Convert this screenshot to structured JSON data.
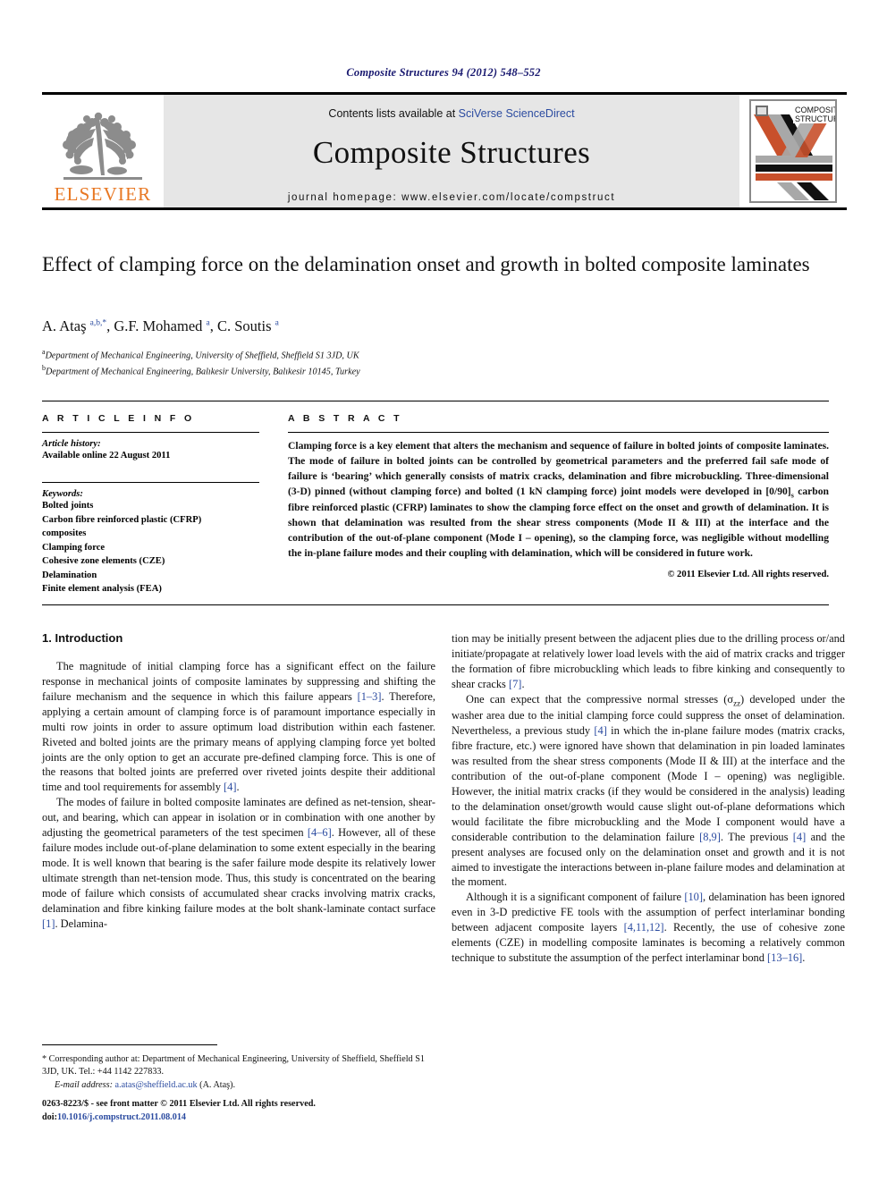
{
  "running_head": "Composite Structures 94 (2012) 548–552",
  "header": {
    "contents_prefix": "Contents lists available at ",
    "contents_link": "SciVerse ScienceDirect",
    "journal_title": "Composite Structures",
    "homepage": "journal homepage: www.elsevier.com/locate/compstruct",
    "publisher_logo_text": "ELSEVIER",
    "cover_title_line1": "COMPOSITE",
    "cover_title_line2": "STRUCTURES",
    "accent_link_color": "#2b4ba0",
    "elsevier_orange": "#E87722"
  },
  "article": {
    "title": "Effect of clamping force on the delamination onset and growth in bolted composite laminates",
    "authors_html": "A. Ataş <sup>a,b,</sup><sup>*</sup>, G.F. Mohamed <sup>a</sup>, C. Soutis <sup>a</sup>",
    "affiliations": [
      "Department of Mechanical Engineering, University of Sheffield, Sheffield S1 3JD, UK",
      "Department of Mechanical Engineering, Balıkesir University, Balıkesir 10145, Turkey"
    ]
  },
  "article_info": {
    "heading": "A R T I C L E   I N F O",
    "history_label": "Article history:",
    "history_value": "Available online 22 August 2011",
    "keywords_label": "Keywords:",
    "keywords": [
      "Bolted joints",
      "Carbon fibre reinforced plastic (CFRP)",
      "composites",
      "Clamping force",
      "Cohesive zone elements (CZE)",
      "Delamination",
      "Finite element analysis (FEA)"
    ]
  },
  "abstract": {
    "heading": "A B S T R A C T",
    "text": "Clamping force is a key element that alters the mechanism and sequence of failure in bolted joints of composite laminates. The mode of failure in bolted joints can be controlled by geometrical parameters and the preferred fail safe mode of failure is ‘bearing’ which generally consists of matrix cracks, delamination and fibre microbuckling. Three-dimensional (3-D) pinned (without clamping force) and bolted (1 kN clamping force) joint models were developed in [0/90]s carbon fibre reinforced plastic (CFRP) laminates to show the clamping force effect on the onset and growth of delamination. It is shown that delamination was resulted from the shear stress components (Mode II & III) at the interface and the contribution of the out-of-plane component (Mode I – opening), so the clamping force, was negligible without modelling the in-plane failure modes and their coupling with delamination, which will be considered in future work.",
    "copyright": "© 2011 Elsevier Ltd. All rights reserved."
  },
  "body": {
    "section_heading": "1. Introduction",
    "left_paragraphs": [
      "The magnitude of initial clamping force has a significant effect on the failure response in mechanical joints of composite laminates by suppressing and shifting the failure mechanism and the sequence in which this failure appears [1–3]. Therefore, applying a certain amount of clamping force is of paramount importance especially in multi row joints in order to assure optimum load distribution within each fastener. Riveted and bolted joints are the primary means of applying clamping force yet bolted joints are the only option to get an accurate pre-defined clamping force. This is one of the reasons that bolted joints are preferred over riveted joints despite their additional time and tool requirements for assembly [4].",
      "The modes of failure in bolted composite laminates are defined as net-tension, shear-out, and bearing, which can appear in isolation or in combination with one another by adjusting the geometrical parameters of the test specimen [4–6]. However, all of these failure modes include out-of-plane delamination to some extent especially in the bearing mode. It is well known that bearing is the safer failure mode despite its relatively lower ultimate strength than net-tension mode. Thus, this study is concentrated on the bearing mode of failure which consists of accumulated shear cracks involving matrix cracks, delamination and fibre kinking failure modes at the bolt shank-laminate contact surface [1]. Delamina-"
    ],
    "right_paragraphs": [
      "tion may be initially present between the adjacent plies due to the drilling process or/and initiate/propagate at relatively lower load levels with the aid of matrix cracks and trigger the formation of fibre microbuckling which leads to fibre kinking and consequently to shear cracks [7].",
      "One can expect that the compressive normal stresses (σzz) developed under the washer area due to the initial clamping force could suppress the onset of delamination. Nevertheless, a previous study [4] in which the in-plane failure modes (matrix cracks, fibre fracture, etc.) were ignored have shown that delamination in pin loaded laminates was resulted from the shear stress components (Mode II & III) at the interface and the contribution of the out-of-plane component (Mode I – opening) was negligible. However, the initial matrix cracks (if they would be considered in the analysis) leading to the delamination onset/growth would cause slight out-of-plane deformations which would facilitate the fibre microbuckling and the Mode I component would have a considerable contribution to the delamination failure [8,9]. The previous [4] and the present analyses are focused only on the delamination onset and growth and it is not aimed to investigate the interactions between in-plane failure modes and delamination at the moment.",
      "Although it is a significant component of failure [10], delamination has been ignored even in 3-D predictive FE tools with the assumption of perfect interlaminar bonding between adjacent composite layers [4,11,12]. Recently, the use of cohesive zone elements (CZE) in modelling composite laminates is becoming a relatively common technique to substitute the assumption of the perfect interlaminar bond [13–16]."
    ]
  },
  "footnotes": {
    "corresponding_author": "* Corresponding author at: Department of Mechanical Engineering, University of Sheffield, Sheffield S1 3JD, UK. Tel.: +44 1142 227833.",
    "email_label": "E-mail address:",
    "email": "a.atas@sheffield.ac.uk",
    "email_suffix": "(A. Ataş).",
    "issn_line": "0263-8223/$ - see front matter © 2011 Elsevier Ltd. All rights reserved.",
    "doi_label": "doi:",
    "doi_value": "10.1016/j.compstruct.2011.08.014"
  }
}
